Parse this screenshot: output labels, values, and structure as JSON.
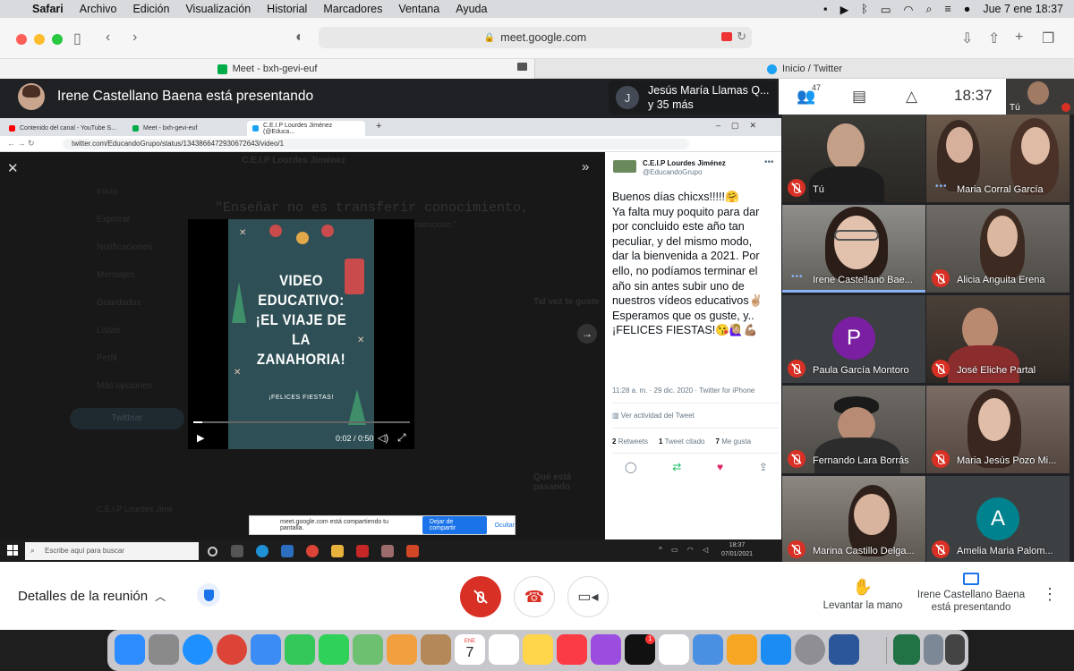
{
  "menubar": {
    "items": [
      "Safari",
      "Archivo",
      "Edición",
      "Visualización",
      "Historial",
      "Marcadores",
      "Ventana",
      "Ayuda"
    ],
    "clock": "Jue 7 ene  18:37"
  },
  "safari": {
    "url": "meet.google.com",
    "tabs": {
      "meet": "Meet - bxh-gevi-euf",
      "twitter": "Inicio / Twitter"
    }
  },
  "meet": {
    "presenter_banner": "Irene Castellano Baena está presentando",
    "chip_name": "Jesús María Llamas Q...",
    "chip_more": "y 35 más",
    "chip_initial": "J",
    "participants_count": "47",
    "clock": "18:37",
    "self_label": "Tú"
  },
  "shared_screen": {
    "tabs": [
      "Contenido del canal - YouTube S...",
      "Meet - bxh-gevi-euf",
      "C.E.I.P Lourdes Jiménez (@Educa..."
    ],
    "address": "twitter.com/EducandoGrupo/status/1343866472930672643/video/1",
    "ghost": {
      "account": "C.E.I.P Lourdes Jiménez",
      "quote": "\"Enseñar no es transferir conocimiento,",
      "quote2": "sino crear las posibilidades de su producción o de su construcción.\"",
      "nav": [
        "Inicio",
        "Explorar",
        "Notificaciones",
        "Mensajes",
        "Guardados",
        "Listas",
        "Perfil",
        "Más opciones"
      ],
      "tweet_btn": "Twittear",
      "side_head": "Tal vez te guste",
      "side_head2": "Qué está pasando",
      "footer_name": "C.E.I.P Lourdes Jimé"
    },
    "video": {
      "title_lines": [
        "VIDEO",
        "EDUCATIVO:",
        "¡EL VIAJE DE",
        "LA",
        "ZANAHORIA!"
      ],
      "subtitle": "¡FELICES FIESTAS!",
      "time": "0:02 / 0:50",
      "progress": 0.04
    },
    "tweet": {
      "name": "C.E.I.P Lourdes Jiménez",
      "handle": "@EducandoGrupo",
      "text": [
        "Buenos días chicxs!!!!!🤗",
        "Ya falta muy poquito para dar",
        "por concluido este año tan",
        "peculiar, y del mismo modo,",
        "dar la bienvenida a 2021. Por",
        "ello, no podíamos terminar el",
        "año sin antes subir uno de",
        "nuestros vídeos educativos✌🏼",
        "Esperamos que os guste, y..",
        "¡FELICES FIESTAS!😘🙋🏼‍♀️💪🏽"
      ],
      "meta": "11:28 a. m. · 29 dic. 2020 · Twitter for iPhone",
      "activity": "Ver actividad del Tweet",
      "retweets_n": "2",
      "retweets_l": "Retweets",
      "quotes_n": "1",
      "quotes_l": "Tweet citado",
      "likes_n": "7",
      "likes_l": "Me gusta"
    },
    "share_banner": {
      "text": "meet.google.com está compartiendo tu pantalla.",
      "stop": "Dejar de compartir",
      "hide": "Ocultar"
    },
    "taskbar": {
      "search": "Escribe aquí para buscar",
      "time": "18:37",
      "date": "07/01/2021"
    }
  },
  "participants": [
    {
      "name": "Tú",
      "status": "muted"
    },
    {
      "name": "Maria Corral García",
      "status": "talking"
    },
    {
      "name": "Irene Castellano Bae...",
      "status": "talking"
    },
    {
      "name": "Alicia Anguita Erena",
      "status": "muted"
    },
    {
      "name": "Paula García Montoro",
      "status": "muted",
      "initial": "P",
      "color": "#7b1fa2"
    },
    {
      "name": "José Eliche Partal",
      "status": "muted"
    },
    {
      "name": "Fernando Lara Borrás",
      "status": "muted"
    },
    {
      "name": "Maria Jesús Pozo Mi...",
      "status": "muted"
    },
    {
      "name": "Marina Castillo Delga...",
      "status": "muted"
    },
    {
      "name": "Amelia Maria Palom...",
      "status": "muted",
      "initial": "A",
      "color": "#00838f"
    }
  ],
  "controls": {
    "details": "Detalles de la reunión",
    "raise_hand": "Levantar la mano",
    "presenting_1": "Irene Castellano Baena",
    "presenting_2": "está presentando"
  },
  "dock": {
    "calendar_month": "ENE",
    "calendar_day": "7",
    "badge": "1"
  },
  "colors": {
    "meet_bg": "#202124",
    "mute_red": "#d93025",
    "accent_blue": "#1a73e8"
  }
}
